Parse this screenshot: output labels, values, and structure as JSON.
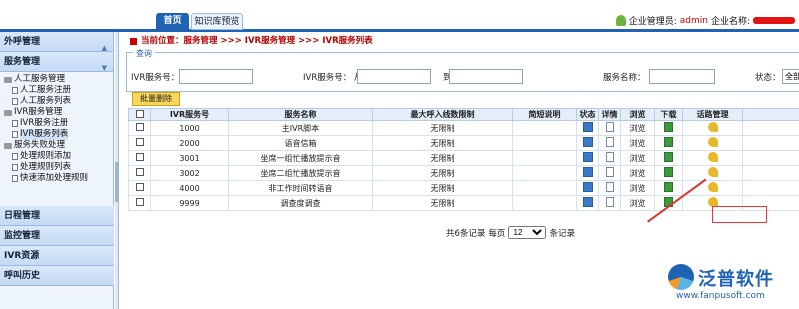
{
  "header": {
    "tabs": [
      {
        "label": "首页",
        "active": true
      },
      {
        "label": "知识库预览",
        "active": false
      }
    ],
    "role_label": "企业管理员:",
    "user": "admin",
    "company_label": "企业名称:"
  },
  "sidebar": {
    "sections_top": [
      "外呼管理",
      "服务管理"
    ],
    "tree": [
      {
        "label": "人工服务管理",
        "type": "folder",
        "level": 0
      },
      {
        "label": "人工服务注册",
        "type": "doc",
        "level": 1
      },
      {
        "label": "人工服务列表",
        "type": "doc",
        "level": 1
      },
      {
        "label": "IVR服务管理",
        "type": "folder",
        "level": 0
      },
      {
        "label": "IVR服务注册",
        "type": "doc",
        "level": 1
      },
      {
        "label": "IVR服务列表",
        "type": "doc",
        "level": 1,
        "active": true
      },
      {
        "label": "服务失败处理",
        "type": "folder",
        "level": 0
      },
      {
        "label": "处理规则添加",
        "type": "doc",
        "level": 1
      },
      {
        "label": "处理规则列表",
        "type": "doc",
        "level": 1
      },
      {
        "label": "快速添加处理规则",
        "type": "doc",
        "level": 1
      }
    ],
    "sections_bottom": [
      "日程管理",
      "监控管理",
      "IVR资源",
      "呼叫历史"
    ]
  },
  "breadcrumb": "当前位置：服务管理 >>> IVR服务管理 >>> IVR服务列表",
  "query": {
    "legend": "查询",
    "ivr_no_label": "IVR服务号：",
    "ivr_from_label": "IVR服务号： 从",
    "to_label": "到",
    "service_name_label": "服务名称：",
    "status_label": "状态：",
    "status_value": "全部"
  },
  "batch_delete": "批量删除",
  "table": {
    "headers": [
      "",
      "IVR服务号",
      "服务名称",
      "最大呼入线数限制",
      "简短说明",
      "状态",
      "详情",
      "浏览",
      "下载",
      "话路管理"
    ],
    "rows": [
      {
        "id": "1000",
        "name": "主IVR脚本",
        "limit": "无限制",
        "desc": "",
        "browse": "浏览"
      },
      {
        "id": "2000",
        "name": "语音信箱",
        "limit": "无限制",
        "desc": "",
        "browse": "浏览"
      },
      {
        "id": "3001",
        "name": "坐席一组忙播放提示音",
        "limit": "无限制",
        "desc": "",
        "browse": "浏览"
      },
      {
        "id": "3002",
        "name": "坐席二组忙播放提示音",
        "limit": "无限制",
        "desc": "",
        "browse": "浏览"
      },
      {
        "id": "4000",
        "name": "非工作时间转语音",
        "limit": "无限制",
        "desc": "",
        "browse": "浏览"
      },
      {
        "id": "9999",
        "name": "调查度调查",
        "limit": "无限制",
        "desc": "",
        "browse": "浏览"
      }
    ]
  },
  "pager": {
    "total_text": "共6条记录",
    "per_page_label": "每页",
    "per_page_value": "12",
    "unit": "条记录"
  },
  "watermark": {
    "brand": "泛普软件",
    "url": "www.fanpusoft.com"
  },
  "colors": {
    "accent": "#1f63b5",
    "breadcrumb": "#b40000",
    "annotation": "#e33333"
  }
}
